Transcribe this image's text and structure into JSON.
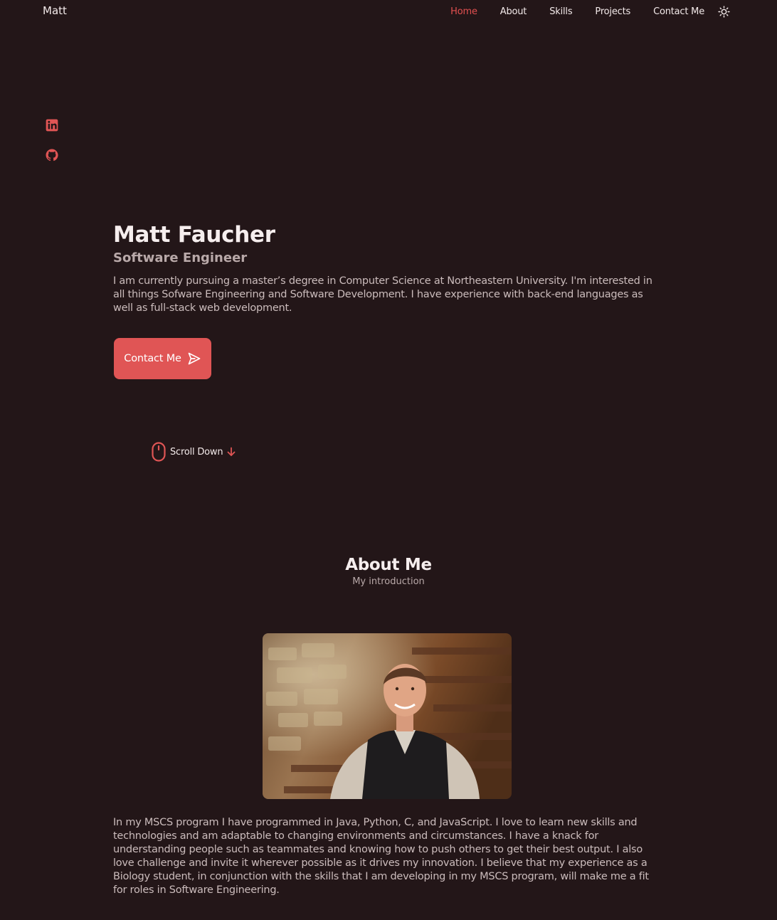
{
  "header": {
    "logo": "Matt",
    "nav": [
      "Home",
      "About",
      "Skills",
      "Projects",
      "Contact Me"
    ],
    "active_nav": "Home",
    "theme_toggle_icon": "sun-icon"
  },
  "social": [
    {
      "icon": "linkedin-icon"
    },
    {
      "icon": "github-icon"
    }
  ],
  "hero": {
    "name": "Matt Faucher",
    "role": "Software Engineer",
    "description": "I am currently pursuing a master’s degree in Computer Science at Northeastern University. I'm interested in all things Sofware Engineering and Software Development. I have experience with back-end languages as well as full-stack web development.",
    "contact_button": "Contact Me",
    "contact_icon": "send-icon"
  },
  "scroll": {
    "label": "Scroll Down",
    "mouse_icon": "mouse-icon",
    "arrow_icon": "arrow-down-icon"
  },
  "about": {
    "title": "About Me",
    "subtitle": "My introduction",
    "photo": "profile-photo",
    "text": "In my MSCS program I have programmed in Java, Python, C, and JavaScript. I love to learn new skills and technologies and am adaptable to changing environments and circumstances. I have a knack for understanding people such as teammates and knowing how to push others to get their best output. I also love challenge and invite it wherever possible as it drives my innovation. I believe that my experience as a Biology student, in conjunction with the skills that I am developing in my MSCS program, will make me a fit for roles in Software Engineering."
  },
  "colors": {
    "background": "#231618",
    "accent": "#e05555",
    "text": "#f3eaea"
  }
}
